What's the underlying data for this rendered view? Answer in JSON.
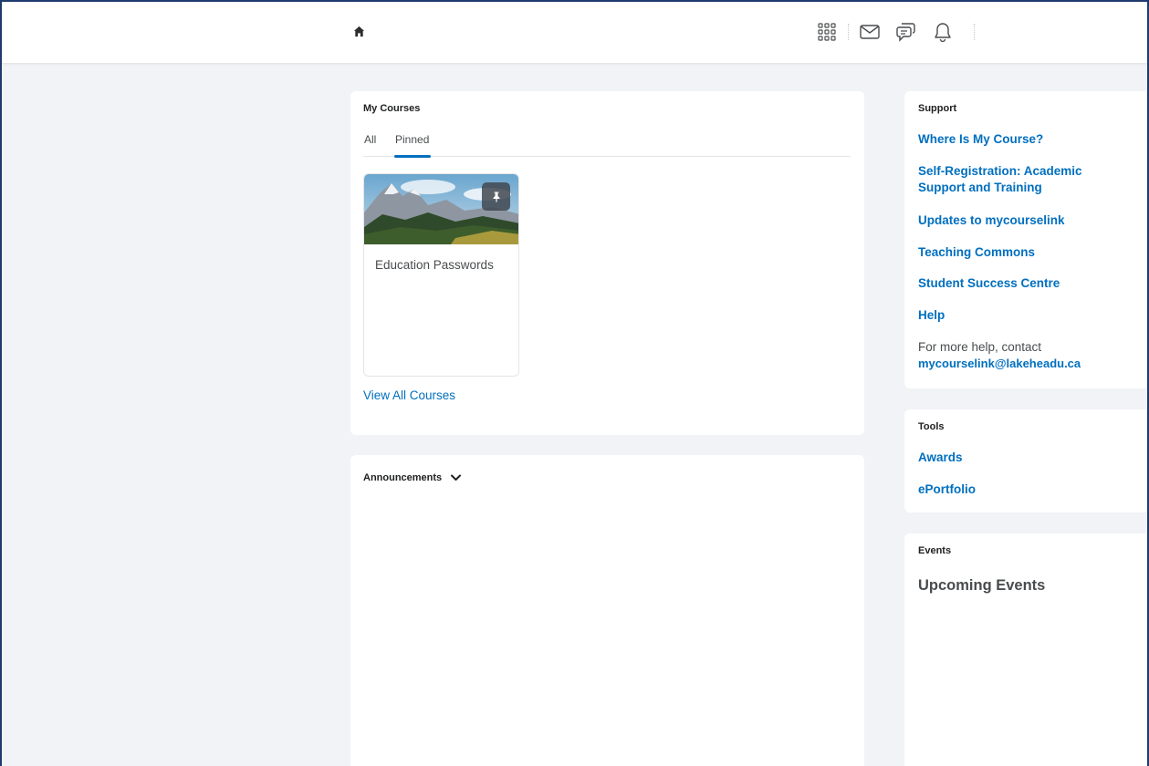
{
  "navbar": {
    "home_icon": "home-icon",
    "icons": [
      "grid-icon",
      "mail-icon",
      "chat-icon",
      "bell-icon"
    ]
  },
  "my_courses": {
    "title": "My Courses",
    "tabs": [
      {
        "label": "All",
        "active": false
      },
      {
        "label": "Pinned",
        "active": true
      }
    ],
    "course": {
      "name": "Education Passwords",
      "pinned": true
    },
    "view_all": "View All Courses"
  },
  "announcements": {
    "title": "Announcements"
  },
  "support": {
    "title": "Support",
    "links": [
      "Where Is My Course?",
      "Self-Registration: Academic Support and Training",
      "Updates to mycourselink",
      "Teaching Commons",
      "Student Success Centre",
      "Help"
    ],
    "help_text": "For more help, contact",
    "help_email": "mycourselink@lakeheadu.ca"
  },
  "tools": {
    "title": "Tools",
    "links": [
      "Awards",
      "ePortfolio"
    ]
  },
  "events": {
    "title": "Events",
    "heading": "Upcoming Events"
  },
  "colors": {
    "link": "#006fbf",
    "background": "#f1f3f6",
    "frame": "#1f3a6e"
  }
}
